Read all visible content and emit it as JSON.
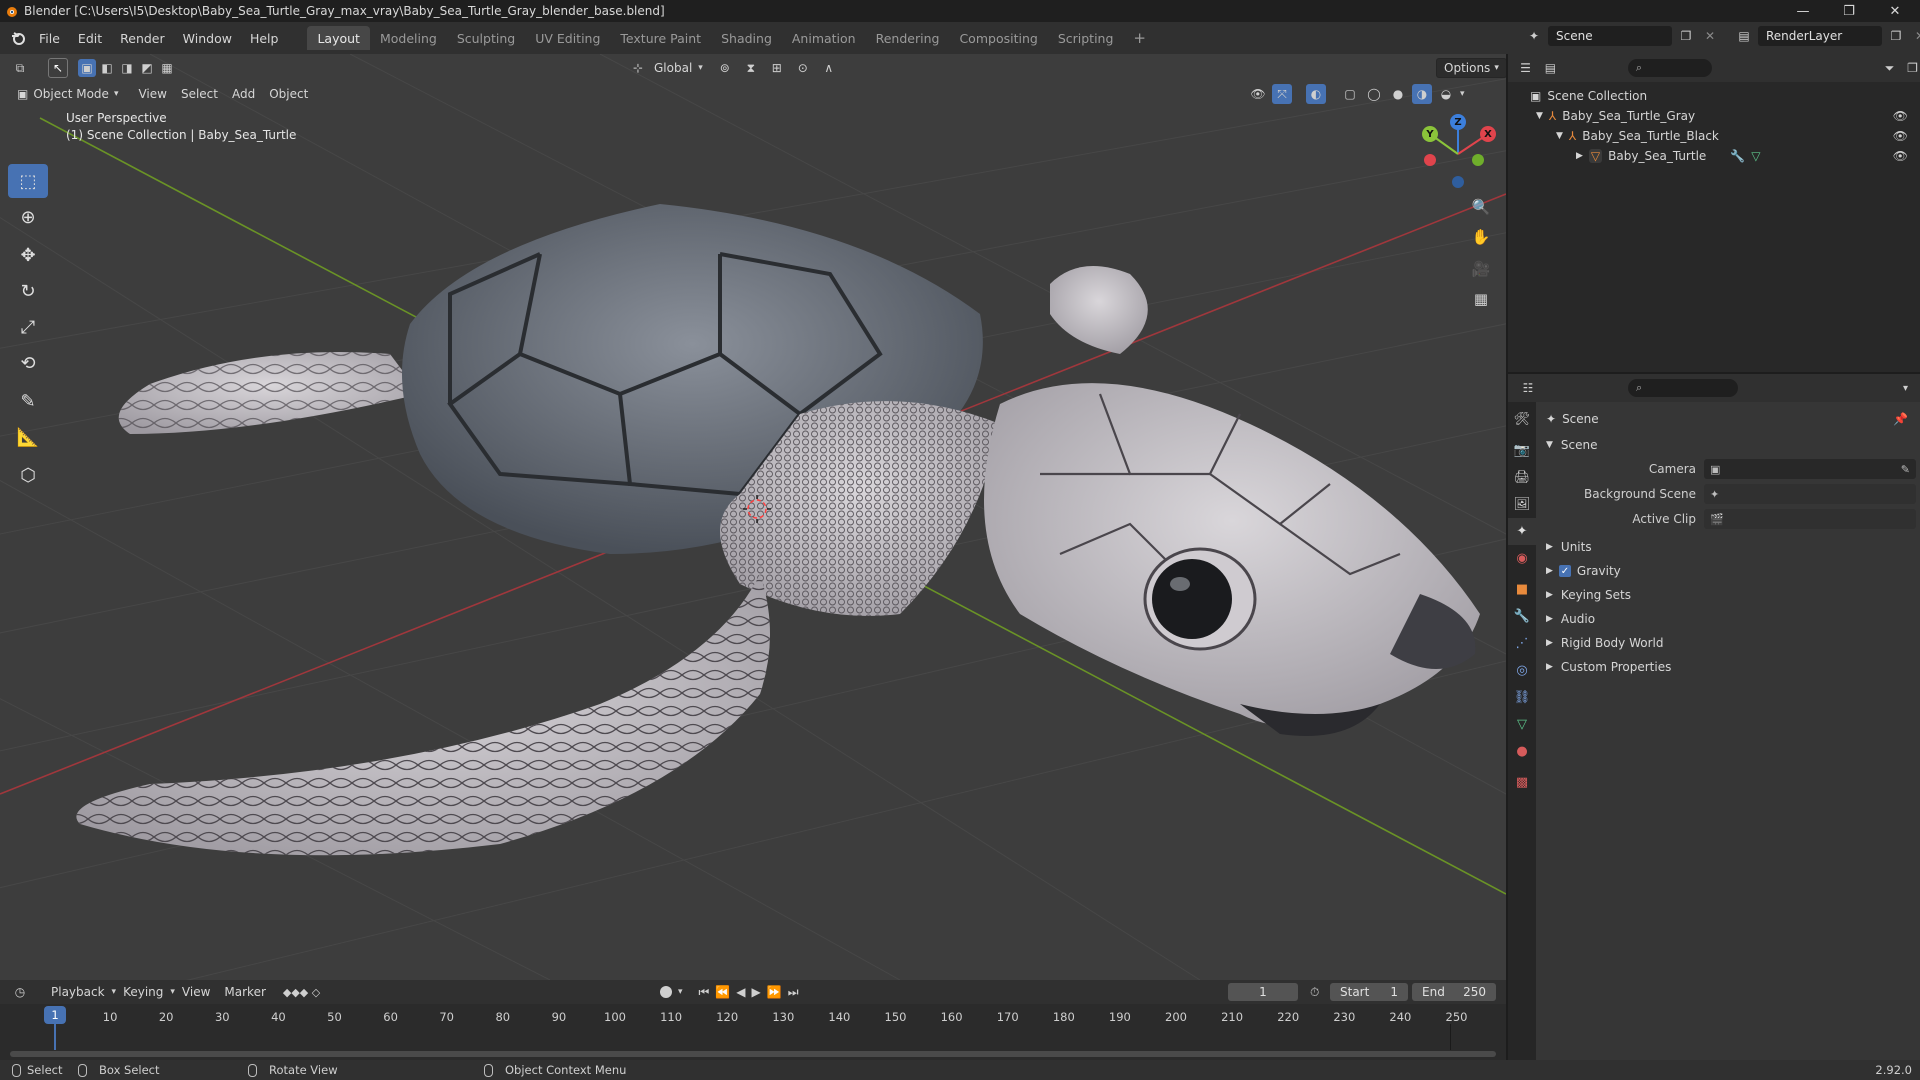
{
  "window": {
    "title": "Blender [C:\\Users\\I5\\Desktop\\Baby_Sea_Turtle_Gray_max_vray\\Baby_Sea_Turtle_Gray_blender_base.blend]",
    "minimize": "—",
    "maximize": "❐",
    "close": "✕"
  },
  "menubar": {
    "menus": [
      "File",
      "Edit",
      "Render",
      "Window",
      "Help"
    ],
    "workspaces": [
      "Layout",
      "Modeling",
      "Sculpting",
      "UV Editing",
      "Texture Paint",
      "Shading",
      "Animation",
      "Rendering",
      "Compositing",
      "Scripting"
    ],
    "active_workspace": "Layout",
    "add_tab": "+",
    "scene_label": "Scene",
    "render_layer_label": "RenderLayer"
  },
  "viewport": {
    "orientation": "Global",
    "options_label": "Options",
    "mode": "Object Mode",
    "menus": [
      "View",
      "Select",
      "Add",
      "Object"
    ],
    "perspective_label": "User Perspective",
    "collection_label": "(1) Scene Collection | Baby_Sea_Turtle",
    "gizmo_axes": {
      "x": "X",
      "y": "Y",
      "z": "Z"
    },
    "colors": {
      "background": "#3d3d3d",
      "x_axis": "#e0444c",
      "y_axis": "#8bc43a",
      "z_axis": "#3c7fdc",
      "active_tool": "#4772b3"
    }
  },
  "outliner": {
    "rows": [
      {
        "label": "Scene Collection"
      },
      {
        "label": "Baby_Sea_Turtle_Gray"
      },
      {
        "label": "Baby_Sea_Turtle_Black"
      },
      {
        "label": "Baby_Sea_Turtle"
      }
    ]
  },
  "properties": {
    "context_label": "Scene",
    "panel_title": "Scene",
    "camera_label": "Camera",
    "background_scene_label": "Background Scene",
    "active_clip_label": "Active Clip",
    "sections": [
      "Units",
      "Gravity",
      "Keying Sets",
      "Audio",
      "Rigid Body World",
      "Custom Properties"
    ],
    "gravity_checked": true
  },
  "timeline": {
    "menus": [
      "Playback",
      "Keying",
      "View",
      "Marker"
    ],
    "current_frame": "1",
    "start_label": "Start",
    "start_value": "1",
    "end_label": "End",
    "end_value": "250",
    "frame_marker": "1",
    "ticks": [
      "10",
      "20",
      "30",
      "40",
      "50",
      "60",
      "70",
      "80",
      "90",
      "100",
      "110",
      "120",
      "130",
      "140",
      "150",
      "160",
      "170",
      "180",
      "190",
      "200",
      "210",
      "220",
      "230",
      "240",
      "250"
    ]
  },
  "statusbar": {
    "select": "Select",
    "box_select": "Box Select",
    "rotate_view": "Rotate View",
    "context_menu": "Object Context Menu",
    "version": "2.92.0"
  }
}
